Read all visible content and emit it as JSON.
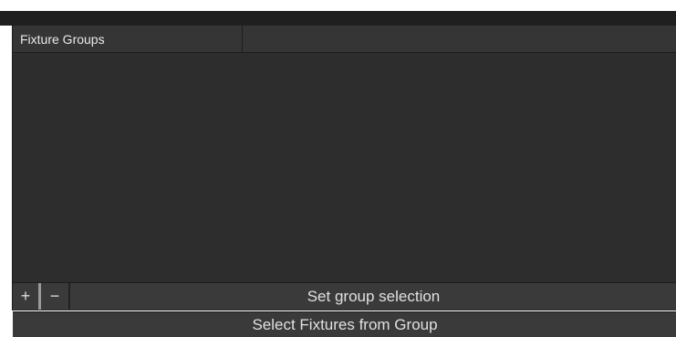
{
  "panel": {
    "header": {
      "column_name": "Fixture Groups",
      "column_extra": ""
    },
    "toolbar": {
      "add_symbol": "+",
      "remove_symbol": "−",
      "set_group_label": "Set group selection"
    },
    "select_fixtures_label": "Select Fixtures from Group"
  }
}
